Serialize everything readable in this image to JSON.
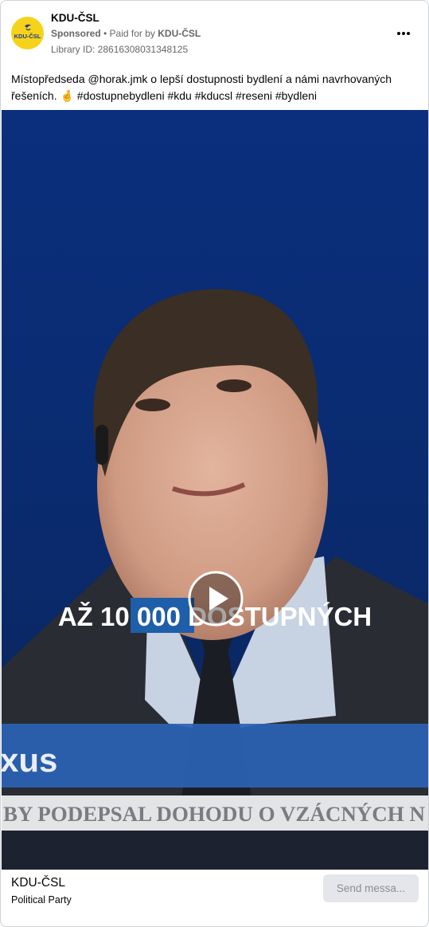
{
  "ad": {
    "page_name": "KDU-ČSL",
    "sponsored": "Sponsored",
    "paid_for_prefix": "• Paid for by",
    "paid_for_name": "KDU-ČSL",
    "library_id": "Library ID: 28616308031348125",
    "logo_text": "KDU-ČSL",
    "caption": "Místopředseda @horak.jmk o lepší dostupnosti bydlení a námi navrhovaných řešeních. 🤞 #dostupnebydleni #kdu #kducsl #reseni #bydleni"
  },
  "video": {
    "subtitle_before": "AŽ 10 ",
    "subtitle_highlight": "000",
    "subtitle_after": " DOSTUPNÝCH",
    "channel_text": "xus",
    "ticker_text": "BY PODEPSAL DOHODU O VZÁCNÝCH N"
  },
  "footer": {
    "advertiser_name": "KDU-ČSL",
    "advertiser_type": "Political Party",
    "cta_label": "Send messa..."
  },
  "colors": {
    "logo_yellow": "#f7d21a",
    "studio_blue": "#0a2e78",
    "subtitle_highlight": "#1f5ea8"
  },
  "icons": [
    "more-options-icon",
    "play-icon"
  ]
}
